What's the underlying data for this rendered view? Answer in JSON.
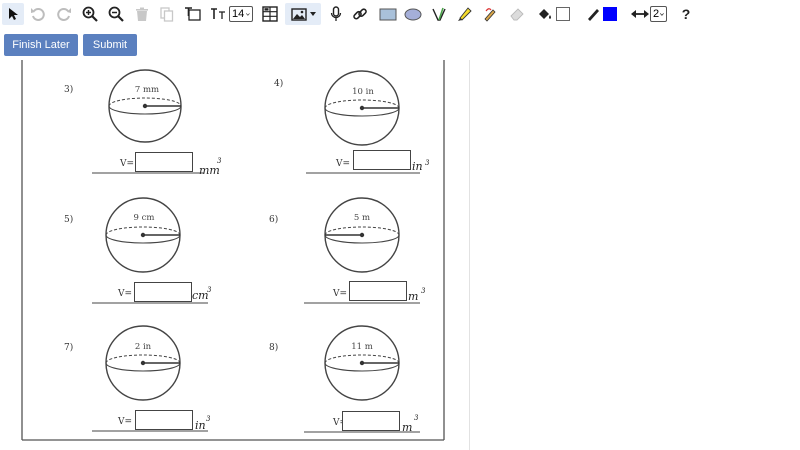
{
  "toolbar": {
    "font_size": "14",
    "line_width": "2",
    "pen_color": "#0000ff",
    "fill_color": "#ffffff",
    "highlighter_color": "#ffd500",
    "tools": [
      "select-arrow-icon",
      "undo-icon",
      "redo-icon",
      "zoom-in-icon",
      "zoom-out-icon",
      "trash-icon",
      "copy-icon",
      "text-box-icon",
      "font-size-icon",
      "table-icon",
      "image-icon",
      "microphone-icon",
      "link-icon",
      "rectangle-icon",
      "ellipse-icon",
      "pen-icon",
      "highlighter-icon",
      "pencil-icon",
      "eraser-icon",
      "fill-bucket-icon",
      "color-marker-icon",
      "line-width-icon",
      "help-icon"
    ],
    "help_label": "?"
  },
  "actions": {
    "finish_later": "Finish Later",
    "submit": "Submit"
  },
  "worksheet": {
    "problems": [
      {
        "number": "3)",
        "measure": "7 mm",
        "v_label": "V=",
        "unit": "mm",
        "exp": "3",
        "answer": ""
      },
      {
        "number": "4)",
        "measure": "10 in",
        "v_label": "V=",
        "unit": "in",
        "exp": "3",
        "answer": ""
      },
      {
        "number": "5)",
        "measure": "9 cm",
        "v_label": "V=",
        "unit": "cm",
        "exp": "3",
        "answer": ""
      },
      {
        "number": "6)",
        "measure": "5 m",
        "v_label": "V=",
        "unit": "m",
        "exp": "3",
        "answer": ""
      },
      {
        "number": "7)",
        "measure": "2 in",
        "v_label": "V=",
        "unit": "in",
        "exp": "3",
        "answer": ""
      },
      {
        "number": "8)",
        "measure": "11 m",
        "v_label": "V=",
        "unit": "m",
        "exp": "3",
        "answer": ""
      }
    ]
  }
}
